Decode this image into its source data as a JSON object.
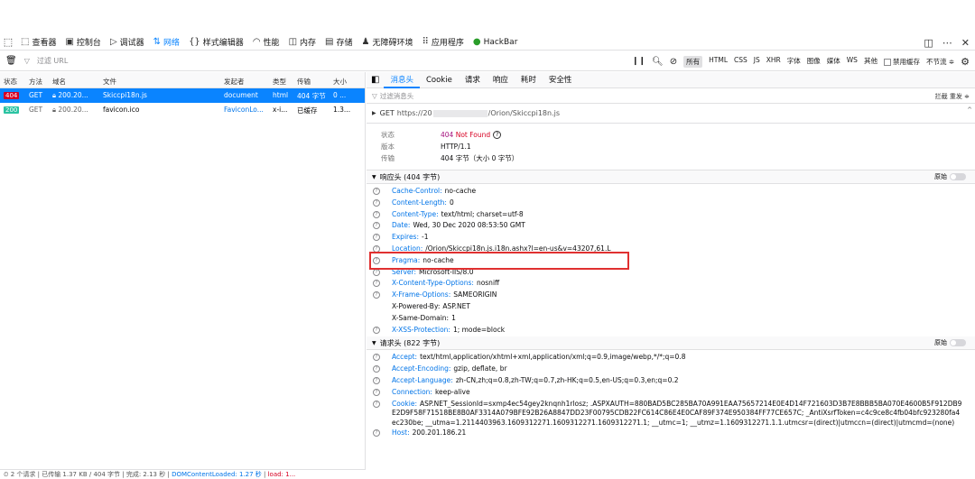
{
  "toolbar": {
    "tabs": [
      {
        "icon": "⬚",
        "label": "查看器"
      },
      {
        "icon": "▣",
        "label": "控制台"
      },
      {
        "icon": "▷",
        "label": "调试器"
      },
      {
        "icon": "⇅",
        "label": "网络"
      },
      {
        "icon": "{}",
        "label": "样式编辑器"
      },
      {
        "icon": "◠",
        "label": "性能"
      },
      {
        "icon": "◫",
        "label": "内存"
      },
      {
        "icon": "▤",
        "label": "存储"
      },
      {
        "icon": "♟",
        "label": "无障碍环境"
      },
      {
        "icon": "⠿",
        "label": "应用程序"
      },
      {
        "icon": "●",
        "label": "HackBar"
      }
    ],
    "selected_tab": "网络"
  },
  "filter": {
    "placeholder": "过滤 URL",
    "types": [
      "所有",
      "HTML",
      "CSS",
      "JS",
      "XHR",
      "字体",
      "图像",
      "媒体",
      "WS",
      "其他"
    ],
    "selected_type": "所有",
    "disable_cache": "禁用缓存",
    "throttle": "不节流 ≑"
  },
  "table": {
    "headers": [
      "状态",
      "方法",
      "域名",
      "文件",
      "发起者",
      "类型",
      "传输",
      "大小"
    ],
    "rows": [
      {
        "status": "404",
        "method": "GET",
        "domain": "200.20...",
        "file": "Skiccpi18n.js",
        "initiator": "document",
        "type": "html",
        "transfer": "404 字节",
        "size": "0 ..."
      },
      {
        "status": "200",
        "method": "GET",
        "domain": "200.20...",
        "file": "favicon.ico",
        "initiator": "FaviconLo...",
        "type": "x-i...",
        "transfer": "已缓存",
        "size": "1.3..."
      }
    ]
  },
  "status_bar": {
    "requests": "2 个请求",
    "transferred": "已传输 1.37 KB / 404 字节",
    "finish": "完成: 2.13 秒",
    "dcl": "DOMContentLoaded: 1.27 秒",
    "load": "load: 1..."
  },
  "details": {
    "tabs": [
      "消息头",
      "Cookie",
      "请求",
      "响应",
      "耗时",
      "安全性"
    ],
    "selected_tab": "消息头",
    "filter_placeholder": "过滤消息头",
    "filter_actions": "拦截 重发 ≑",
    "request_line": {
      "method": "GET",
      "url_prefix": "https://20",
      "url_suffix": "/Orion/Skiccpi18n.js"
    },
    "summary": {
      "status_label": "状态",
      "status_code": "404",
      "status_text": "Not Found",
      "version_label": "版本",
      "version": "HTTP/1.1",
      "transfer_label": "传输",
      "transfer": "404 字节（大小 0 字节）"
    },
    "response_section": "响应头 (404 字节)",
    "raw_label": "原始",
    "response_headers": [
      {
        "name": "Cache-Control:",
        "value": "no-cache",
        "link": true
      },
      {
        "name": "Content-Length:",
        "value": "0",
        "link": true
      },
      {
        "name": "Content-Type:",
        "value": "text/html; charset=utf-8",
        "link": true
      },
      {
        "name": "Date:",
        "value": "Wed, 30 Dec 2020 08:53:50 GMT",
        "link": true
      },
      {
        "name": "Expires:",
        "value": "-1",
        "link": true
      },
      {
        "name": "Location:",
        "value": "/Orion/Skiccpi18n.js.i18n.ashx?l=en-us&v=43207,61.L",
        "link": true
      },
      {
        "name": "Pragma:",
        "value": "no-cache",
        "link": true
      },
      {
        "name": "Server:",
        "value": "Microsoft-IIS/8.0",
        "link": true
      },
      {
        "name": "X-Content-Type-Options:",
        "value": "nosniff",
        "link": true
      },
      {
        "name": "X-Frame-Options:",
        "value": "SAMEORIGIN",
        "link": true
      },
      {
        "name": "X-Powered-By:",
        "value": "ASP.NET",
        "link": true
      },
      {
        "name": "X-Same-Domain:",
        "value": "1",
        "link": true
      },
      {
        "name": "X-XSS-Protection:",
        "value": "1; mode=block",
        "link": true
      }
    ],
    "request_section": "请求头 (822 字节)",
    "request_headers": [
      {
        "name": "Accept:",
        "value": "text/html,application/xhtml+xml,application/xml;q=0.9,image/webp,*/*;q=0.8"
      },
      {
        "name": "Accept-Encoding:",
        "value": "gzip, deflate, br"
      },
      {
        "name": "Accept-Language:",
        "value": "zh-CN,zh;q=0.8,zh-TW;q=0.7,zh-HK;q=0.5,en-US;q=0.3,en;q=0.2"
      },
      {
        "name": "Connection:",
        "value": "keep-alive"
      },
      {
        "name": "Cookie:",
        "value": "ASP.NET_SessionId=sxmp4ec54gey2knqnh1rlosz; .ASPXAUTH=880BAD5BC285BA70A991EAA75657214E0E4D14F721603D3B7E8BBB5BA070E4600B5F912DB9E2D9F58F71518BE8B0AF3314A079BFE92B26A8847DD23F00795CDB22FC614C86E4E0CAF89F374E950384FF77CE657C; _AntiXsrfToken=c4c9ce8c4fb04bfc923280fa4ec230be; __utma=1.2114403963.1609312271.1609312271.1609312271.1; __utmc=1; __utmz=1.1609312271.1.1.utmcsr=(direct)|utmccn=(direct)|utmcmd=(none)"
      },
      {
        "name": "Host:",
        "value": "200.201.186.21"
      }
    ]
  }
}
